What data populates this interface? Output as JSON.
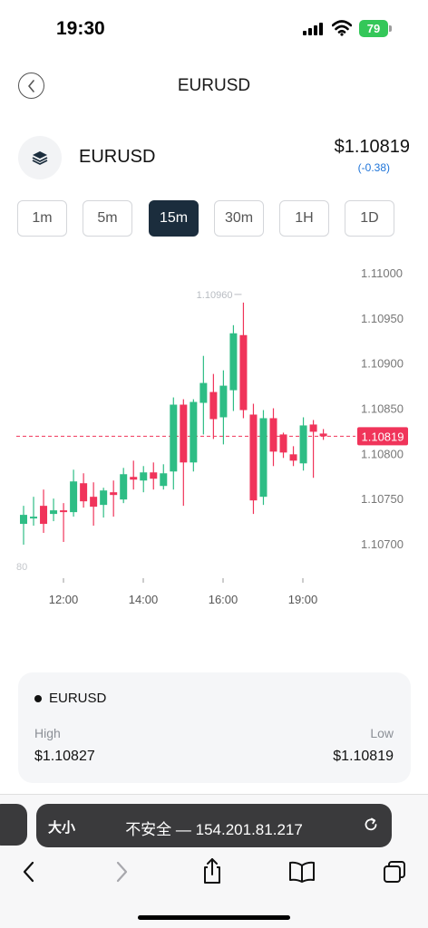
{
  "status_bar": {
    "time": "19:30",
    "battery": "79"
  },
  "header": {
    "title": "EURUSD"
  },
  "asset": {
    "name": "EURUSD",
    "price": "$1.10819",
    "change": "(-0.38)"
  },
  "timeframes": [
    {
      "label": "1m",
      "active": false
    },
    {
      "label": "5m",
      "active": false
    },
    {
      "label": "15m",
      "active": true
    },
    {
      "label": "30m",
      "active": false
    },
    {
      "label": "1H",
      "active": false
    },
    {
      "label": "1D",
      "active": false
    }
  ],
  "chart_data": {
    "type": "candlestick",
    "x_ticks": [
      "12:00",
      "14:00",
      "16:00",
      "19:00"
    ],
    "y_ticks": [
      "1.11000",
      "1.10950",
      "1.10900",
      "1.10850",
      "1.10800",
      "1.10750",
      "1.10700"
    ],
    "ylim": [
      1.1068,
      1.1103
    ],
    "current_price": 1.10819,
    "current_price_label": "1.10819",
    "max_annotation": "1.10960",
    "min_annotation_fragment": "80",
    "colors": {
      "up": "#2ebd85",
      "down": "#f0345a"
    },
    "candles": [
      {
        "t": "11:15",
        "open": 1.10722,
        "high": 1.10742,
        "low": 1.10699,
        "close": 1.10732
      },
      {
        "t": "11:30",
        "open": 1.1073,
        "high": 1.10752,
        "low": 1.1072,
        "close": 1.1073
      },
      {
        "t": "11:45",
        "open": 1.10742,
        "high": 1.1076,
        "low": 1.10712,
        "close": 1.10722
      },
      {
        "t": "12:00",
        "open": 1.10733,
        "high": 1.1075,
        "low": 1.10725,
        "close": 1.10737
      },
      {
        "t": "12:15",
        "open": 1.10737,
        "high": 1.10745,
        "low": 1.10702,
        "close": 1.10735
      },
      {
        "t": "12:30",
        "open": 1.10735,
        "high": 1.10782,
        "low": 1.1073,
        "close": 1.10769
      },
      {
        "t": "12:45",
        "open": 1.10767,
        "high": 1.10778,
        "low": 1.1074,
        "close": 1.10747
      },
      {
        "t": "13:00",
        "open": 1.10752,
        "high": 1.10768,
        "low": 1.1072,
        "close": 1.10741
      },
      {
        "t": "13:15",
        "open": 1.10743,
        "high": 1.10762,
        "low": 1.10729,
        "close": 1.10759
      },
      {
        "t": "13:30",
        "open": 1.10757,
        "high": 1.1077,
        "low": 1.1073,
        "close": 1.10754
      },
      {
        "t": "13:45",
        "open": 1.10749,
        "high": 1.10784,
        "low": 1.10745,
        "close": 1.10777
      },
      {
        "t": "14:00",
        "open": 1.10774,
        "high": 1.10792,
        "low": 1.1076,
        "close": 1.10771
      },
      {
        "t": "14:15",
        "open": 1.1077,
        "high": 1.10786,
        "low": 1.10757,
        "close": 1.10779
      },
      {
        "t": "14:30",
        "open": 1.10779,
        "high": 1.1079,
        "low": 1.1076,
        "close": 1.10772
      },
      {
        "t": "14:45",
        "open": 1.10764,
        "high": 1.10788,
        "low": 1.1076,
        "close": 1.10778
      },
      {
        "t": "15:00",
        "open": 1.1078,
        "high": 1.10862,
        "low": 1.1076,
        "close": 1.10854
      },
      {
        "t": "15:15",
        "open": 1.10854,
        "high": 1.1086,
        "low": 1.10742,
        "close": 1.1079
      },
      {
        "t": "15:30",
        "open": 1.1079,
        "high": 1.1086,
        "low": 1.1078,
        "close": 1.10857
      },
      {
        "t": "15:45",
        "open": 1.10856,
        "high": 1.10908,
        "low": 1.10821,
        "close": 1.10878
      },
      {
        "t": "16:00",
        "open": 1.10868,
        "high": 1.10888,
        "low": 1.10816,
        "close": 1.10838
      },
      {
        "t": "16:15",
        "open": 1.1084,
        "high": 1.10892,
        "low": 1.1081,
        "close": 1.10875
      },
      {
        "t": "16:30",
        "open": 1.1087,
        "high": 1.10942,
        "low": 1.10847,
        "close": 1.10933
      },
      {
        "t": "16:45",
        "open": 1.10931,
        "high": 1.10967,
        "low": 1.10839,
        "close": 1.10848
      },
      {
        "t": "17:00",
        "open": 1.10843,
        "high": 1.10855,
        "low": 1.10733,
        "close": 1.10748
      },
      {
        "t": "17:15",
        "open": 1.10752,
        "high": 1.10848,
        "low": 1.10743,
        "close": 1.10839
      },
      {
        "t": "17:30",
        "open": 1.10839,
        "high": 1.1085,
        "low": 1.10786,
        "close": 1.10802
      },
      {
        "t": "17:45",
        "open": 1.10821,
        "high": 1.10823,
        "low": 1.10795,
        "close": 1.10801
      },
      {
        "t": "18:00",
        "open": 1.10799,
        "high": 1.10808,
        "low": 1.10786,
        "close": 1.10792
      },
      {
        "t": "18:15",
        "open": 1.10789,
        "high": 1.1084,
        "low": 1.10781,
        "close": 1.10831
      },
      {
        "t": "18:30",
        "open": 1.10832,
        "high": 1.10837,
        "low": 1.10773,
        "close": 1.10824
      },
      {
        "t": "18:45",
        "open": 1.10822,
        "high": 1.10827,
        "low": 1.10815,
        "close": 1.10819
      }
    ]
  },
  "info_card": {
    "name": "EURUSD",
    "high_label": "High",
    "high_value": "$1.10827",
    "low_label": "Low",
    "low_value": "$1.10819"
  },
  "browser": {
    "text_size_label": "大小",
    "url_text": "不安全 — 154.201.81.217"
  },
  "icons": {
    "back": "chevron-left-icon",
    "asset": "layers-icon",
    "reload": "reload-icon",
    "nav_back": "chevron-left-icon",
    "nav_forward": "chevron-right-icon",
    "share": "share-icon",
    "bookmarks": "book-icon",
    "tabs": "tabs-icon"
  }
}
